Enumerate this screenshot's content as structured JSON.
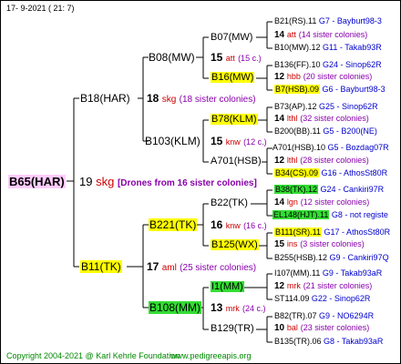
{
  "header": {
    "date": "17-  9-2021  (  21:  7)"
  },
  "root": {
    "name": "B65(HAR)",
    "number": "19",
    "code": "skg",
    "note": "[Drones from 16 sister colonies]"
  },
  "gen1": [
    {
      "name": "B18(HAR)",
      "number": "18",
      "code": "skg",
      "note": "(18 sister colonies)"
    },
    {
      "name": "B11(TK)",
      "number": "17",
      "code": "aml",
      "note": "(25 sister colonies)"
    }
  ],
  "gen2": [
    {
      "name": "B08(MW)",
      "number": "15",
      "code": "att",
      "note": "(15 c.)"
    },
    {
      "name": "B103(KLM)",
      "number": "15",
      "code": "knw",
      "note": "(12 c.)"
    },
    {
      "name": "B221(TK)",
      "number": "16",
      "code": "knw",
      "note": "(16 c.)"
    },
    {
      "name": "B108(MM)",
      "number": "13",
      "code": "mrk",
      "note": "(24 c.)"
    }
  ],
  "gen3": [
    {
      "name": "B07(MW)"
    },
    {
      "name": "B16(MW)"
    },
    {
      "name": "B78(KLM)"
    },
    {
      "name": "A701(HSB)"
    },
    {
      "name": "B22(TK)"
    },
    {
      "name": "B125(WX)"
    },
    {
      "name": "I1(MM)"
    },
    {
      "name": "B129(TR)"
    }
  ],
  "gen3_mid": [
    {
      "number": "14",
      "code": "att",
      "note": "(14 sister colonies)"
    },
    {
      "number": "12",
      "code": "hbb",
      "note": "(20 sister colonies)"
    },
    {
      "number": "14",
      "code": "lthl",
      "note": "(32 sister colonies)"
    },
    {
      "number": "12",
      "code": "lthl",
      "note": "(28 sister colonies)"
    },
    {
      "number": "14",
      "code": "lgn",
      "note": "(12 sister colonies)"
    },
    {
      "number": "15",
      "code": "ins",
      "note": "(3 sister colonies)"
    },
    {
      "number": "12",
      "code": "mrk",
      "note": "(21 sister colonies)"
    },
    {
      "number": "10",
      "code": "bal",
      "note": "(23 sister colonies)"
    }
  ],
  "gen4": [
    {
      "name": "B21(RS).11",
      "ref": "G7 - Bayburt98-3"
    },
    {
      "name": "B10(MW).12",
      "ref": "G11 - Takab93R"
    },
    {
      "name": "B136(FF).10",
      "ref": "G24 - Sinop62R"
    },
    {
      "name": "B7(HSB).09",
      "ref": "G6 - Bayburt98-3"
    },
    {
      "name": "B73(AP).12",
      "ref": "G25 - Sinop62R"
    },
    {
      "name": "B200(BB).11",
      "ref": "G5 - B200(NE)"
    },
    {
      "name": "A701(HSB).10",
      "ref": "G5 - Bozdag07R"
    },
    {
      "name": "B34(CS).09",
      "ref": "G16 - AthosSt80R"
    },
    {
      "name": "B38(TK).12",
      "ref": "G24 - Cankiri97R"
    },
    {
      "name": "EL148(HJT).11",
      "ref": "G8 - not registe"
    },
    {
      "name": "B111(SR).11",
      "ref": "G17 - AthosSt80R"
    },
    {
      "name": "B255(HSB).12",
      "ref": "G9 - Cankiri97Q"
    },
    {
      "name": "I107(MM).11",
      "ref": "G9 - Takab93aR"
    },
    {
      "name": "ST114.09",
      "ref": "G22 - Sinop62R"
    },
    {
      "name": "B82(TR).07",
      "ref": "G9 - NO6294R"
    },
    {
      "name": "B135(TR).06",
      "ref": "G8 - Takab93aR"
    }
  ],
  "footer": {
    "copyright": "Copyright 2004-2021 @ Karl Kehrle Foundation",
    "site": "www.pedigreeapis.org"
  },
  "colors": {
    "highlight_yellow": "#ffff00",
    "highlight_green": "#33dd33",
    "highlight_pink": "#ffccff",
    "ref_blue": "#0000cc",
    "code_red": "#cc0000"
  }
}
